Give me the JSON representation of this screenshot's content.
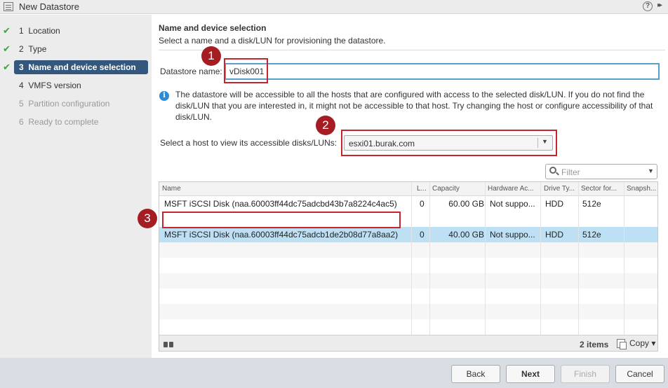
{
  "window": {
    "title": "New Datastore",
    "help_icon": "?",
    "expand_icon": "▸▸"
  },
  "steps": [
    {
      "num": "1",
      "label": "Location",
      "state": "done"
    },
    {
      "num": "2",
      "label": "Type",
      "state": "done"
    },
    {
      "num": "3",
      "label": "Name and device selection",
      "state": "active"
    },
    {
      "num": "4",
      "label": "VMFS version",
      "state": "next"
    },
    {
      "num": "5",
      "label": "Partition configuration",
      "state": "future"
    },
    {
      "num": "6",
      "label": "Ready to complete",
      "state": "future"
    }
  ],
  "main": {
    "heading": "Name and device selection",
    "subheading": "Select a name and a disk/LUN for provisioning the datastore.",
    "datastore_name_label": "Datastore name:",
    "datastore_name_value": "vDisk001",
    "info_text": "The datastore will be accessible to all the hosts that are configured with access to the selected disk/LUN. If you do not find the disk/LUN that you are interested in, it might not be accessible to that host. Try changing the host or configure accessibility of that disk/LUN.",
    "host_label": "Select a host to view its accessible disks/LUNs:",
    "host_value": "esxi01.burak.com",
    "filter_placeholder": "Filter"
  },
  "annotations": [
    "1",
    "2",
    "3"
  ],
  "table": {
    "columns": [
      "Name",
      "L...",
      "Capacity",
      "Hardware Ac...",
      "Drive Ty...",
      "Sector for...",
      "Snapsh..."
    ],
    "rows": [
      {
        "name": "MSFT iSCSI Disk (naa.60003ff44dc75adcbd43b7a8224c4ac5)",
        "lun": "0",
        "capacity": "60.00 GB",
        "hw": "Not suppo...",
        "drive": "HDD",
        "sector": "512e",
        "snapshot": ""
      },
      {
        "name": "MSFT iSCSI Disk (naa.60003ff44dc75adcb1de2b08d77a8aa2)",
        "lun": "0",
        "capacity": "40.00 GB",
        "hw": "Not suppo...",
        "drive": "HDD",
        "sector": "512e",
        "snapshot": ""
      }
    ],
    "item_count": "2 items",
    "copy_label": "Copy ▾"
  },
  "buttons": {
    "back": "Back",
    "next": "Next",
    "finish": "Finish",
    "cancel": "Cancel"
  },
  "colors": {
    "accent": "#34587d",
    "selected_row": "#bde0f5",
    "annotation_red": "#c8242b",
    "check_green": "#3aa53a"
  }
}
